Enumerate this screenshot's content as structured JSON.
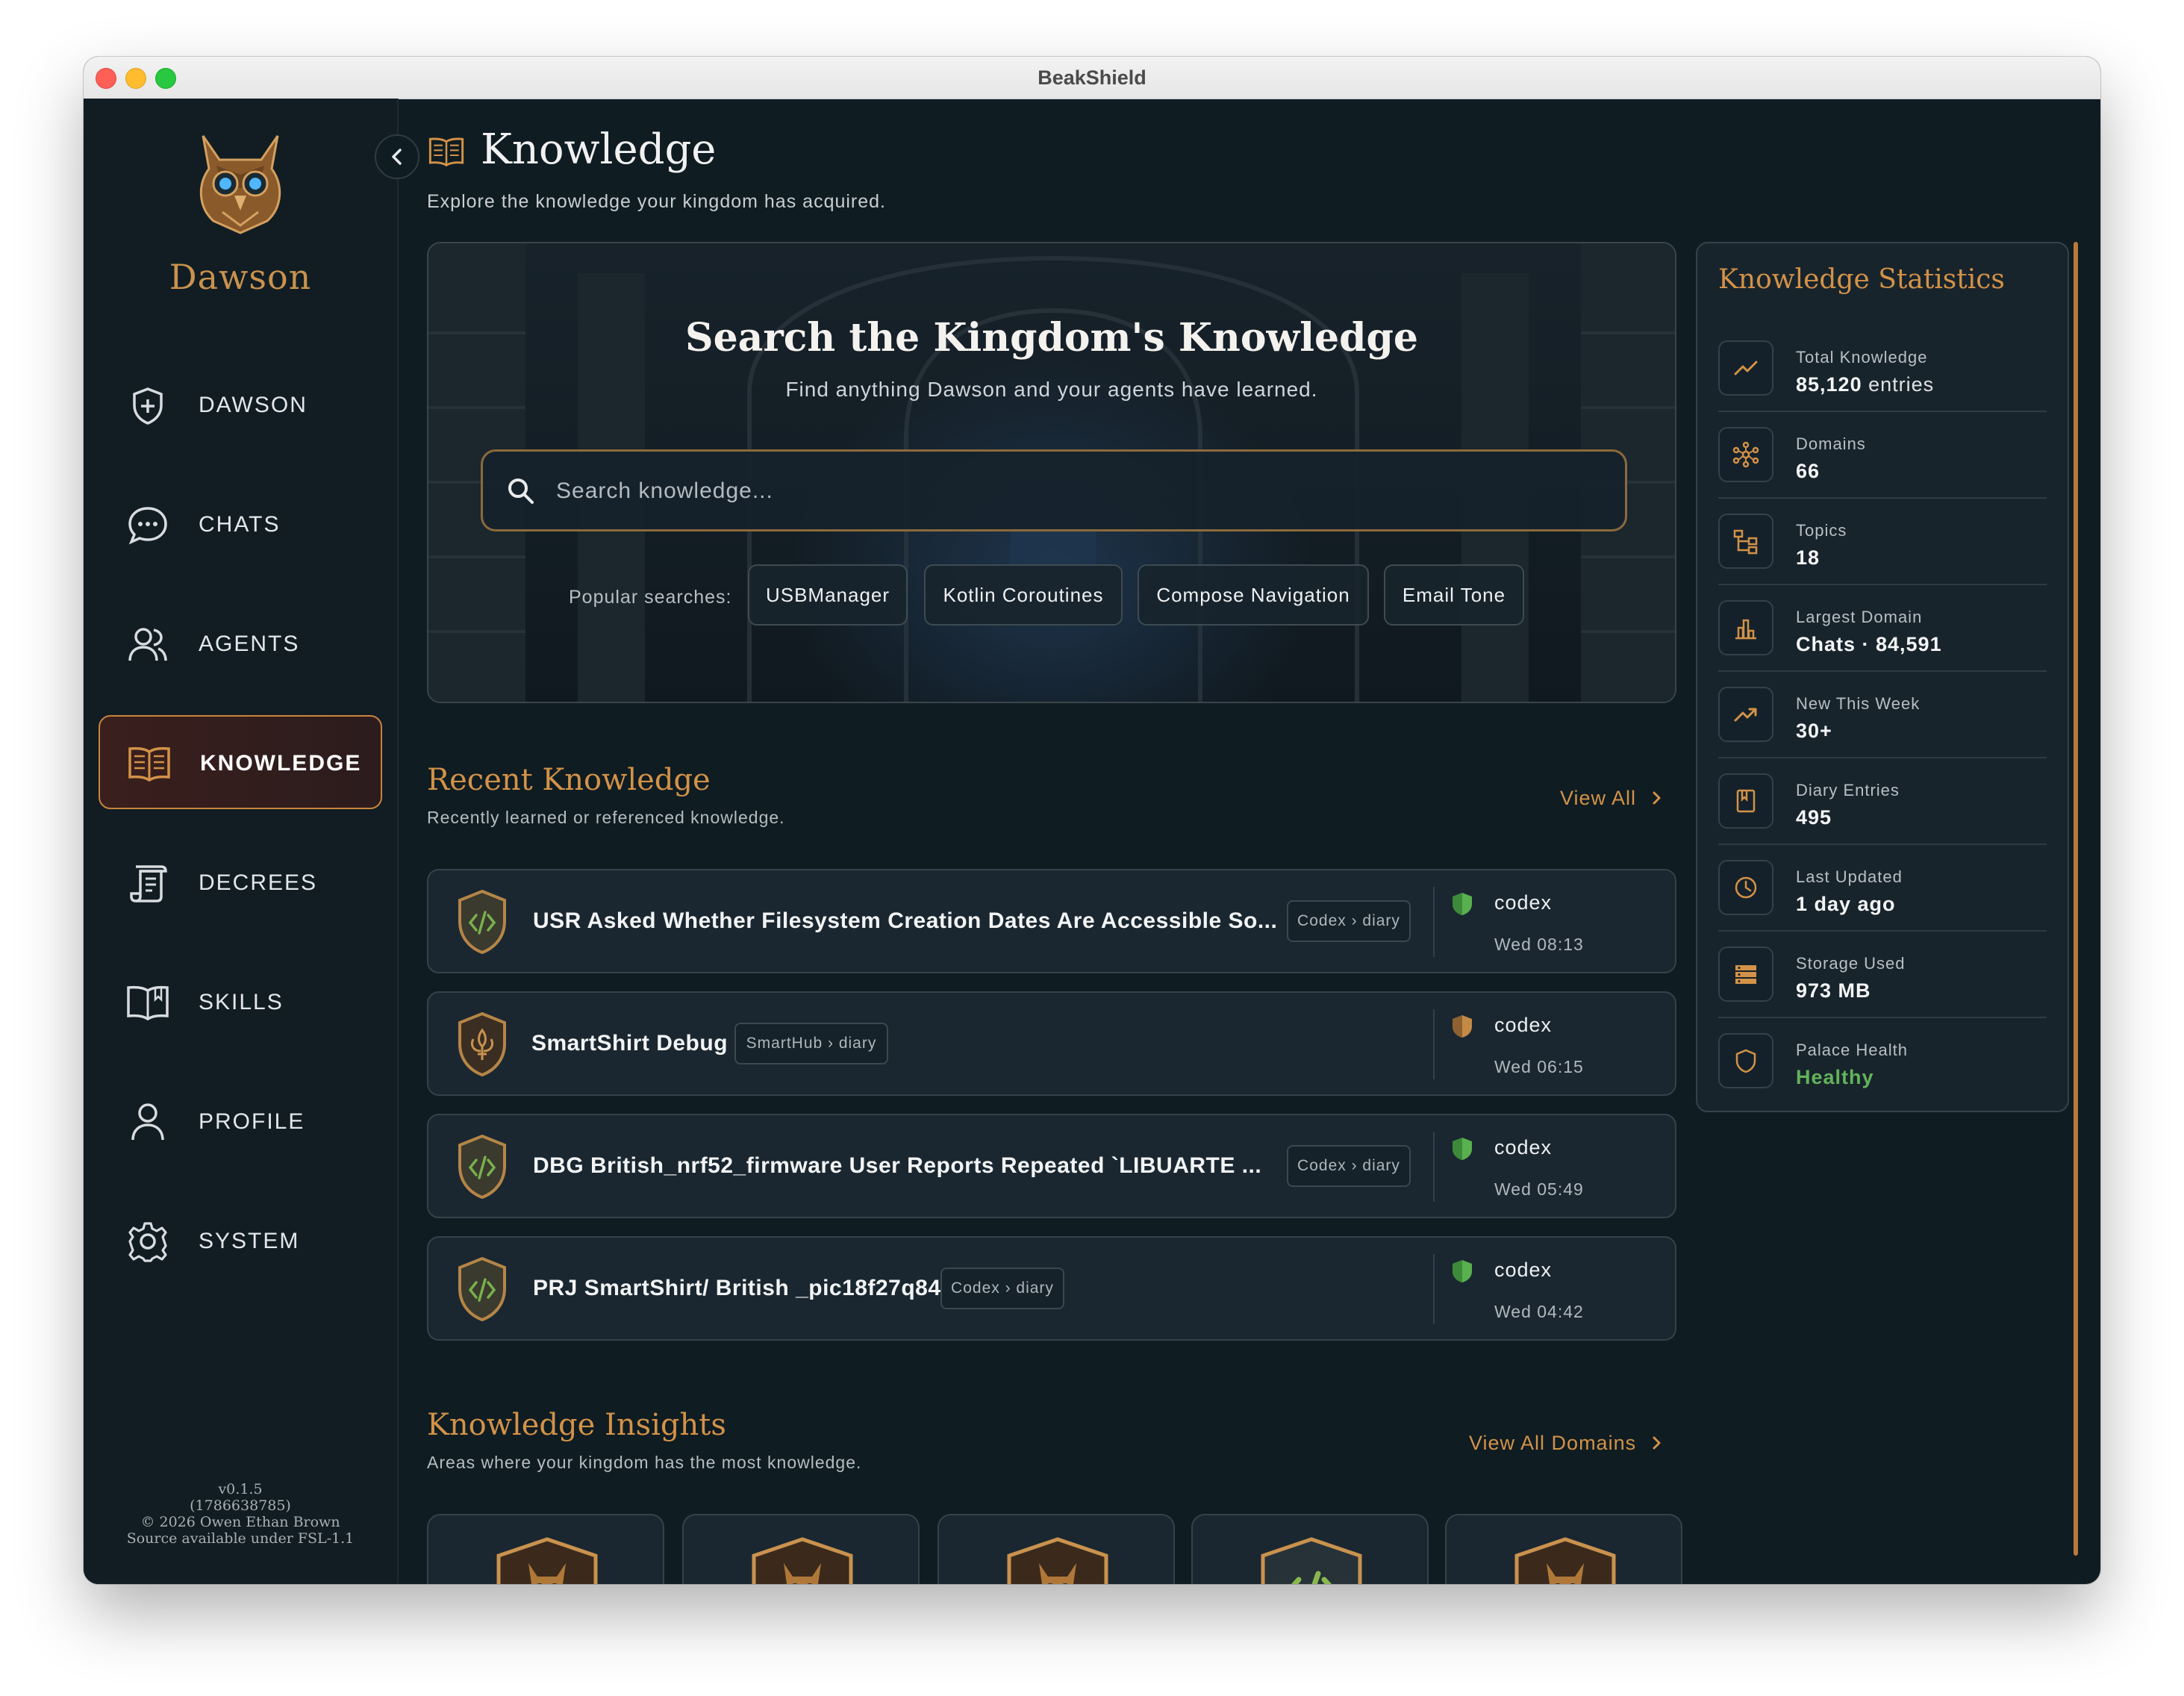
{
  "window": {
    "title": "BeakShield"
  },
  "sidebar": {
    "logo_text": "Dawson",
    "items": [
      {
        "label": "DAWSON",
        "icon": "shield-plus-icon"
      },
      {
        "label": "CHATS",
        "icon": "chat-bubble-icon"
      },
      {
        "label": "AGENTS",
        "icon": "users-icon"
      },
      {
        "label": "KNOWLEDGE",
        "icon": "open-book-icon",
        "active": true
      },
      {
        "label": "DECREES",
        "icon": "scroll-icon"
      },
      {
        "label": "SKILLS",
        "icon": "book-icon"
      },
      {
        "label": "PROFILE",
        "icon": "person-icon"
      },
      {
        "label": "SYSTEM",
        "icon": "gear-icon"
      }
    ],
    "footer": {
      "version": "v0.1.5",
      "build": "(1786638785)",
      "copyright": "© 2026 Owen Ethan Brown",
      "license": "Source available under FSL-1.1"
    }
  },
  "page": {
    "title": "Knowledge",
    "subtitle": "Explore the knowledge your kingdom has acquired."
  },
  "hero": {
    "title": "Search the Kingdom's Knowledge",
    "subtitle": "Find anything Dawson and your agents have learned.",
    "search_placeholder": "Search knowledge...",
    "popular_label": "Popular searches:",
    "popular": [
      "USBManager",
      "Kotlin Coroutines",
      "Compose Navigation",
      "Email Tone"
    ]
  },
  "recent": {
    "title": "Recent Knowledge",
    "subtitle": "Recently learned or referenced knowledge.",
    "view_all": "View All",
    "items": [
      {
        "title": "USR Asked Whether Filesystem Creation Dates Are Accessible So...",
        "tag": "Codex › diary",
        "user": "codex",
        "time": "Wed 08:13",
        "crest": "code-crest-icon",
        "status": "green"
      },
      {
        "title": "SmartShirt Debug",
        "tag": "SmartHub › diary",
        "user": "codex",
        "time": "Wed 06:15",
        "crest": "fleur-crest-icon",
        "status": "amber"
      },
      {
        "title": "DBG  British_nrf52_firmware User Reports Repeated `LIBUARTE ...",
        "tag": "Codex › diary",
        "user": "codex",
        "time": "Wed 05:49",
        "crest": "code-crest-icon",
        "status": "green"
      },
      {
        "title": "PRJ SmartShirt/ British _pic18f27q84",
        "tag": "Codex › diary",
        "user": "codex",
        "time": "Wed 04:42",
        "crest": "code-crest-icon",
        "status": "green"
      }
    ]
  },
  "insights": {
    "title": "Knowledge Insights",
    "subtitle": "Areas where your kingdom has the most knowledge.",
    "view_all": "View All Domains",
    "cards": [
      "owl-crest-icon",
      "owl-crest-icon",
      "owl-crest-icon",
      "code-crest-icon",
      "owl-crest-icon"
    ]
  },
  "stats": {
    "title": "Knowledge Statistics",
    "items": [
      {
        "label": "Total Knowledge",
        "value": "85,120",
        "unit": " entries",
        "icon": "trend-line-icon"
      },
      {
        "label": "Domains",
        "value": "66",
        "unit": "",
        "icon": "network-icon"
      },
      {
        "label": "Topics",
        "value": "18",
        "unit": "",
        "icon": "hierarchy-icon"
      },
      {
        "label": "Largest Domain",
        "value": "Chats · 84,591",
        "unit": "",
        "icon": "bar-chart-icon"
      },
      {
        "label": "New This Week",
        "value": "30+",
        "unit": "",
        "icon": "trend-up-icon"
      },
      {
        "label": "Diary Entries",
        "value": "495",
        "unit": "",
        "icon": "bookmark-book-icon"
      },
      {
        "label": "Last Updated",
        "value": "1 day ago",
        "unit": "",
        "icon": "clock-icon"
      },
      {
        "label": "Storage Used",
        "value": "973 MB",
        "unit": "",
        "icon": "storage-icon"
      },
      {
        "label": "Palace Health",
        "value": "Healthy",
        "unit": "",
        "icon": "shield-icon",
        "good": true
      }
    ]
  },
  "colors": {
    "accent": "#d39248",
    "healthy": "#62b35a",
    "background": "#0f1c22"
  }
}
